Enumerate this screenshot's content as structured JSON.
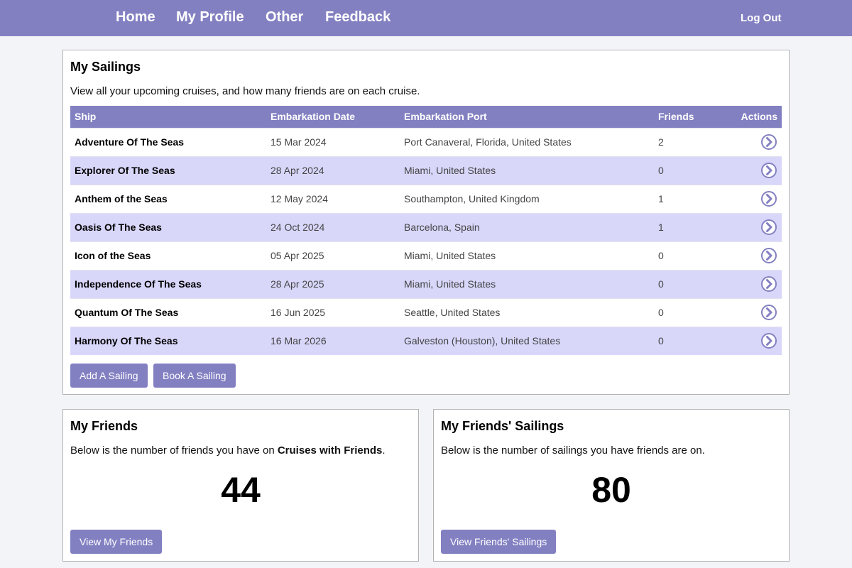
{
  "nav": {
    "home": "Home",
    "profile": "My Profile",
    "other": "Other",
    "feedback": "Feedback",
    "logout": "Log Out"
  },
  "sailings": {
    "title": "My Sailings",
    "description": "View all your upcoming cruises, and how many friends are on each cruise.",
    "columns": {
      "ship": "Ship",
      "date": "Embarkation Date",
      "port": "Embarkation Port",
      "friends": "Friends",
      "actions": "Actions"
    },
    "rows": [
      {
        "ship": "Adventure Of The Seas",
        "date": "15 Mar 2024",
        "port": "Port Canaveral, Florida, United States",
        "friends": "2"
      },
      {
        "ship": "Explorer Of The Seas",
        "date": "28 Apr 2024",
        "port": "Miami, United States",
        "friends": "0"
      },
      {
        "ship": "Anthem of the Seas",
        "date": "12 May 2024",
        "port": "Southampton, United Kingdom",
        "friends": "1"
      },
      {
        "ship": "Oasis Of The Seas",
        "date": "24 Oct 2024",
        "port": "Barcelona, Spain",
        "friends": "1"
      },
      {
        "ship": "Icon of the Seas",
        "date": "05 Apr 2025",
        "port": "Miami, United States",
        "friends": "0"
      },
      {
        "ship": "Independence Of The Seas",
        "date": "28 Apr 2025",
        "port": "Miami, United States",
        "friends": "0"
      },
      {
        "ship": "Quantum Of The Seas",
        "date": "16 Jun 2025",
        "port": "Seattle, United States",
        "friends": "0"
      },
      {
        "ship": "Harmony Of The Seas",
        "date": "16 Mar 2026",
        "port": "Galveston (Houston), United States",
        "friends": "0"
      }
    ],
    "add_button": "Add A Sailing",
    "book_button": "Book A Sailing"
  },
  "friends": {
    "title": "My Friends",
    "description_prefix": "Below is the number of friends you have on ",
    "description_bold": "Cruises with Friends",
    "description_suffix": ".",
    "count": "44",
    "button": "View My Friends"
  },
  "friends_sailings": {
    "title": "My Friends' Sailings",
    "description": "Below is the number of sailings you have friends are on.",
    "count": "80",
    "button": "View Friends' Sailings"
  },
  "icons": {
    "row_action": "chevron-right-circle-icon"
  },
  "colors": {
    "accent": "#8380c2",
    "row_alt": "#d8d7fa",
    "background": "#f3f4f8"
  }
}
